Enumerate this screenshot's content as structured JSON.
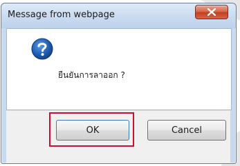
{
  "dialog": {
    "title": "Message from webpage",
    "close_icon": "close-x-icon",
    "message_icon": "question-icon",
    "message": "ยืนยันการลาออก ?",
    "buttons": {
      "ok_label": "OK",
      "cancel_label": "Cancel"
    },
    "highlighted_button": "OK"
  },
  "colors": {
    "highlight": "#c8102e",
    "title_bar": "#c9dbf0",
    "close_button": "#c3401f",
    "question_icon": "#1f5fb4"
  }
}
